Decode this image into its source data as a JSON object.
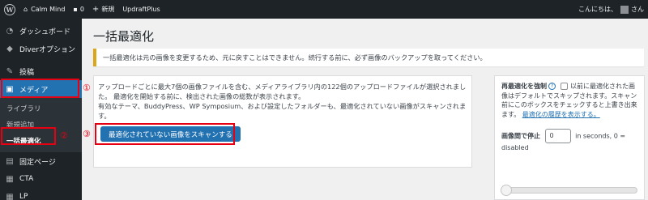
{
  "adminbar": {
    "site_name": "Calm Mind",
    "comments_count": "0",
    "new_label": "新規",
    "plugin_label": "UpdraftPlus",
    "greeting": "こんにちは、",
    "user_suffix": "さん"
  },
  "sidebar": {
    "items": [
      {
        "label": "ダッシュボード",
        "icon": "dashboard-icon"
      },
      {
        "label": "Diverオプション",
        "icon": "diver-icon"
      },
      {
        "label": "投稿",
        "icon": "pin-icon"
      },
      {
        "label": "メディア",
        "icon": "media-icon"
      },
      {
        "label": "固定ページ",
        "icon": "page-icon"
      },
      {
        "label": "CTA",
        "icon": "cta-icon"
      },
      {
        "label": "LP",
        "icon": "lp-icon"
      }
    ],
    "submenu": [
      "ライブラリ",
      "新規追加",
      "一括最適化"
    ]
  },
  "annotations": [
    "①",
    "②",
    "③"
  ],
  "page": {
    "title": "一括最適化",
    "notice": "一括最適化は元の画像を変更するため、元に戻すことはできません。続行する前に、必ず画像のバックアップを取ってください。",
    "description_1": "アップロードごとに最大7個の画像ファイルを含む、メディアライブラリ内の122個のアップロードファイルが選択されました。 最適化を開始する前に、検出された画像の総数が表示されます。",
    "description_2": "有効なテーマ、BuddyPress、WP Symposium、および設定したフォルダーも、最適化されていない画像がスキャンされます。",
    "scan_button": "最適化されていない画像をスキャンする"
  },
  "side": {
    "force_label": "再最適化を強制",
    "help_glyph": "?",
    "force_desc_1": "以前に最適化された画像はデフォルトでスキップされます。スキャン前にこのボックスをチェックすると上書き出来ます。",
    "history_link": "最適化の履歴を表示する。",
    "delay_label": "画像間で停止",
    "delay_value": "0",
    "delay_desc": "in seconds, 0 = disabled",
    "delay_slider_value": 0
  },
  "colors": {
    "accent": "#2271b1",
    "annotation": "#e60012",
    "notice_border": "#dba617"
  }
}
